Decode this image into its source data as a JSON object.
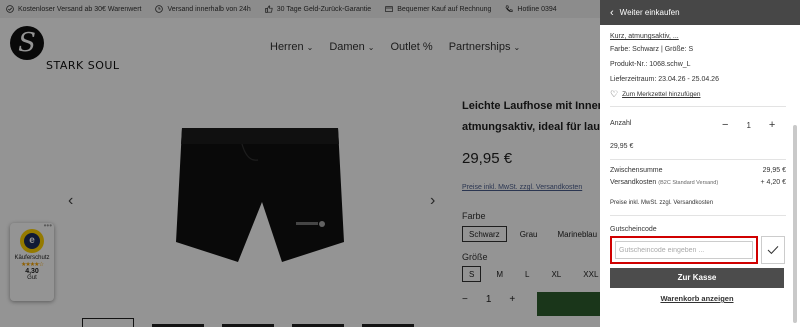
{
  "topbar": {
    "items": [
      "Kostenloser Versand ab 30€ Warenwert",
      "Versand innerhalb von 24h",
      "30 Tage Geld-Zurück-Garantie",
      "Bequemer Kauf auf Rechnung",
      "Hotline 0394"
    ]
  },
  "brand": {
    "name": "STARK SOUL",
    "mark": "S"
  },
  "nav": {
    "items": [
      "Herren",
      "Damen",
      "Outlet %",
      "Partnerships"
    ]
  },
  "product": {
    "title_line1": "Leichte Laufhose mit Innens",
    "title_line2": "atmungsaktiv, ideal für laufe",
    "price": "29,95 €",
    "tax_note": "Preise inkl. MwSt. zzgl. Versandkosten",
    "color_label": "Farbe",
    "colors": [
      "Schwarz",
      "Grau",
      "Marineblau"
    ],
    "size_label": "Größe",
    "sizes": [
      "S",
      "M",
      "L",
      "XL",
      "XXL"
    ],
    "qty": "1"
  },
  "trust_badge": {
    "label": "Käuferschutz",
    "rating": "4,30",
    "grade": "Gut",
    "stars": "★★★★☆",
    "menu": "•••"
  },
  "panel": {
    "back_label": "Weiter einkaufen",
    "item_name": "Kurz, atmungsaktiv, ...",
    "variant": "Farbe: Schwarz | Größe: S",
    "product_no": "Produkt-Nr.: 1068.schw_L",
    "delivery": "Lieferzeitraum: 23.04.26 - 25.04.26",
    "wishlist": "Zum Merkzettel hinzufügen",
    "qty_label": "Anzahl",
    "qty": "1",
    "item_price": "29,95 €",
    "subtotal_label": "Zwischensumme",
    "subtotal_value": "29,95 €",
    "shipping_label": "Versandkosten",
    "shipping_note": "(B2C Standard Versand)",
    "shipping_value": "+ 4,20 €",
    "tax_note": "Preise inkl. MwSt. zzgl. Versandkosten",
    "coupon_label": "Gutscheincode",
    "coupon_placeholder": "Gutscheincode eingeben ...",
    "checkout_label": "Zur Kasse",
    "view_cart_label": "Warenkorb anzeigen"
  }
}
